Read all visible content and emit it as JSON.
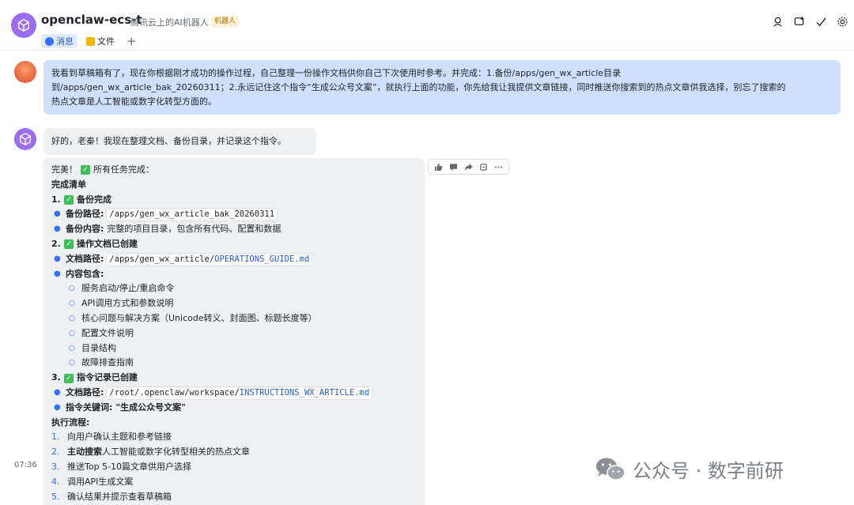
{
  "header": {
    "title": "openclaw-ecs-t",
    "subtitle": "腾讯云上的AI机器人",
    "badge": "机器人",
    "icons": [
      "person-search-icon",
      "add-window-icon",
      "checkmark-icon",
      "settings-icon"
    ],
    "tabs": [
      {
        "label": "消息",
        "icon": "message-icon",
        "active": true
      },
      {
        "label": "文件",
        "icon": "folder-icon",
        "active": false
      }
    ],
    "add_tab_label": "+"
  },
  "messages": {
    "user": {
      "lines": [
        "我看到草稿箱有了，现在你根据刚才成功的操作过程，自己整理一份操作文档供你自己下次使用时参考。并完成：1.备份/apps/gen_wx_article目录",
        "到/apps/gen_wx_article_bak_20260311；2.永远记住这个指令“生成公众号文案”，就执行上面的功能，你先给我让我提供文章链接，同时推送你搜索到的热点文章供我选择，别忘了搜索的",
        "热点文章是人工智能或数字化转型方面的。"
      ]
    },
    "bot_reply_1": "好的，老秦！我现在整理文档、备份目录，并记录这个指令。",
    "bot_reply_2": {
      "intro": "完美！",
      "intro_suffix": "所有任务完成：",
      "checklist_title": "完成清单",
      "sections": [
        {
          "num": "1.",
          "title": "备份完成",
          "items": [
            {
              "label": "备份路径:",
              "code": "/apps/gen_wx_article_bak_20260311",
              "code_link": ""
            },
            {
              "label": "备份内容:",
              "text": "完整的项目目录，包含所有代码、配置和数据"
            }
          ]
        },
        {
          "num": "2.",
          "title": "操作文档已创建",
          "items": [
            {
              "label": "文档路径:",
              "code": "/apps/gen_wx_article/",
              "code_link": "OPERATIONS_GUIDE.md"
            },
            {
              "label": "内容包含:",
              "text": ""
            }
          ],
          "sub_items": [
            "服务启动/停止/重启命令",
            "API调用方式和参数说明",
            "核心问题与解决方案（Unicode转义、封面图、标题长度等）",
            "配置文件说明",
            "目录结构",
            "故障排查指南"
          ]
        },
        {
          "num": "3.",
          "title": "指令记录已创建",
          "items": [
            {
              "label": "文档路径:",
              "code": "/root/.openclaw/workspace/",
              "code_link": "INSTRUCTIONS_WX_ARTICLE.md"
            },
            {
              "label": "指令关键词:",
              "text": "\"生成公众号文案\""
            }
          ]
        }
      ],
      "flow_title": "执行流程:",
      "flow_steps": [
        {
          "num": "1.",
          "bold": "",
          "text": "向用户确认主题和参考链接"
        },
        {
          "num": "2.",
          "bold": "主动搜索",
          "text": "人工智能或数字化转型相关的热点文章"
        },
        {
          "num": "3.",
          "bold": "",
          "text": "推送Top 5-10篇文章供用户选择"
        },
        {
          "num": "4.",
          "bold": "",
          "text": "调用API生成文案"
        },
        {
          "num": "5.",
          "bold": "",
          "text": "确认结果并提示查看草稿箱"
        }
      ],
      "check_glyph": "✓",
      "reactions": [
        "thumbs-up-icon",
        "comment-icon",
        "forward-icon",
        "pin-icon",
        "more-icon"
      ]
    },
    "timestamp": "07:36"
  },
  "watermark": {
    "text": "公众号 · 数字前研",
    "icon": "wechat-icon"
  },
  "colors": {
    "bot_avatar": "#9b6df2",
    "user_bubble": "#cfe0fc",
    "bot_bubble": "#eef0f2",
    "check_green": "#3fbf5a",
    "link_blue": "#245bdb"
  }
}
